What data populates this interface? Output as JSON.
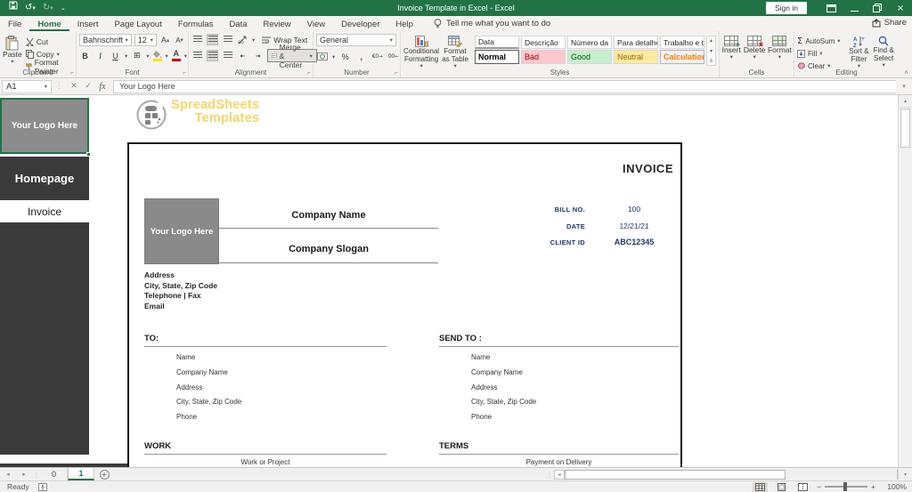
{
  "titlebar": {
    "title": "Invoice Template in Excel  -  Excel",
    "sign_in": "Sign in"
  },
  "ribbon": {
    "tabs": [
      "File",
      "Home",
      "Insert",
      "Page Layout",
      "Formulas",
      "Data",
      "Review",
      "View",
      "Developer",
      "Help"
    ],
    "active_tab": "Home",
    "tell_me": "Tell me what you want to do",
    "share": "Share",
    "groups": {
      "clipboard": {
        "label": "Clipboard",
        "paste": "Paste",
        "cut": "Cut",
        "copy": "Copy",
        "format_painter": "Format Painter"
      },
      "font": {
        "label": "Font",
        "name": "Bahnschrift",
        "size": "12",
        "bold": "B",
        "italic": "I",
        "underline": "U"
      },
      "alignment": {
        "label": "Alignment",
        "wrap": "Wrap Text",
        "merge": "Merge & Center"
      },
      "number": {
        "label": "Number",
        "format": "General",
        "percent": "%",
        "comma": ","
      },
      "styles": {
        "label": "Styles",
        "conditional": "Conditional Formatting",
        "format_table": "Format as Table",
        "chips": [
          {
            "top": "Data",
            "bottom": "Normal"
          },
          {
            "top": "Descrição",
            "bottom": "Bad"
          },
          {
            "top": "Número da F...",
            "bottom": "Good"
          },
          {
            "top": "Para detalhes",
            "bottom": "Neutral"
          },
          {
            "top": "Trabalho e t...",
            "bottom": "Calculation"
          }
        ]
      },
      "cells": {
        "label": "Cells",
        "insert": "Insert",
        "delete": "Delete",
        "format": "Format"
      },
      "editing": {
        "label": "Editing",
        "autosum": "AutoSum",
        "fill": "Fill",
        "clear": "Clear",
        "sort": "Sort & Filter",
        "find": "Find & Select"
      }
    }
  },
  "formula_bar": {
    "name_box": "A1",
    "fx_label": "fx",
    "content": "Your Logo Here"
  },
  "sidebar": {
    "logo": "Your Logo Here",
    "homepage": "Homepage",
    "invoice": "Invoice"
  },
  "watermark": {
    "line1": "SpreadSheets",
    "line2": "Templates"
  },
  "document": {
    "title": "INVOICE",
    "logo": "Your Logo Here",
    "company_name": "Company Name",
    "company_slogan": "Company Slogan",
    "meta": [
      {
        "label": "BILL NO.",
        "value": "100"
      },
      {
        "label": "DATE",
        "value": "12/21/21"
      },
      {
        "label": "CLIENT ID",
        "value": "ABC12345"
      }
    ],
    "address": [
      "Address",
      "City, State, Zip Code",
      "Telephone | Fax",
      "Email"
    ],
    "to": {
      "heading": "TO:",
      "items": [
        "Name",
        "Company Name",
        "Address",
        "City, State, Zip Code",
        "Phone"
      ]
    },
    "send_to": {
      "heading": "SEND TO :",
      "items": [
        "Name",
        "Company Name",
        "Address",
        "City, State, Zip Code",
        "Phone"
      ]
    },
    "work": {
      "heading": "WORK",
      "value": "Work or Project"
    },
    "terms": {
      "heading": "TERMS",
      "value": "Payment on Delivery"
    }
  },
  "sheet_tabs": {
    "tabs": [
      "0",
      "1"
    ],
    "active": "1"
  },
  "status_bar": {
    "ready": "Ready",
    "zoom": "100%"
  },
  "icons": {
    "undo": "↺",
    "redo": "↻",
    "dropdown": "▾",
    "up_small": "▴",
    "down_small": "▾",
    "left_small": "◂",
    "right_small": "▸",
    "close": "×",
    "check": "✓",
    "cancel": "✕",
    "borders": "⊞",
    "sigma": "Σ",
    "ellipsis_v": "⋮",
    "collapse": "∧",
    "plus": "+",
    "qat_chevron": "⌄"
  },
  "colors": {
    "excel_green": "#217346",
    "sidebar_dark": "#3a3a3a",
    "logo_gray": "#8c8c8c",
    "navy": "#1f3864",
    "bad_bg": "#ffc7ce",
    "bad_text": "#9c0006",
    "good_bg": "#c6efce",
    "good_text": "#006100",
    "neutral_bg": "#ffeb9c",
    "neutral_text": "#9c6500",
    "calc_bg": "#f2f2f2",
    "calc_text": "#fa7d00",
    "watermark_yellow": "#f0cf4e"
  }
}
